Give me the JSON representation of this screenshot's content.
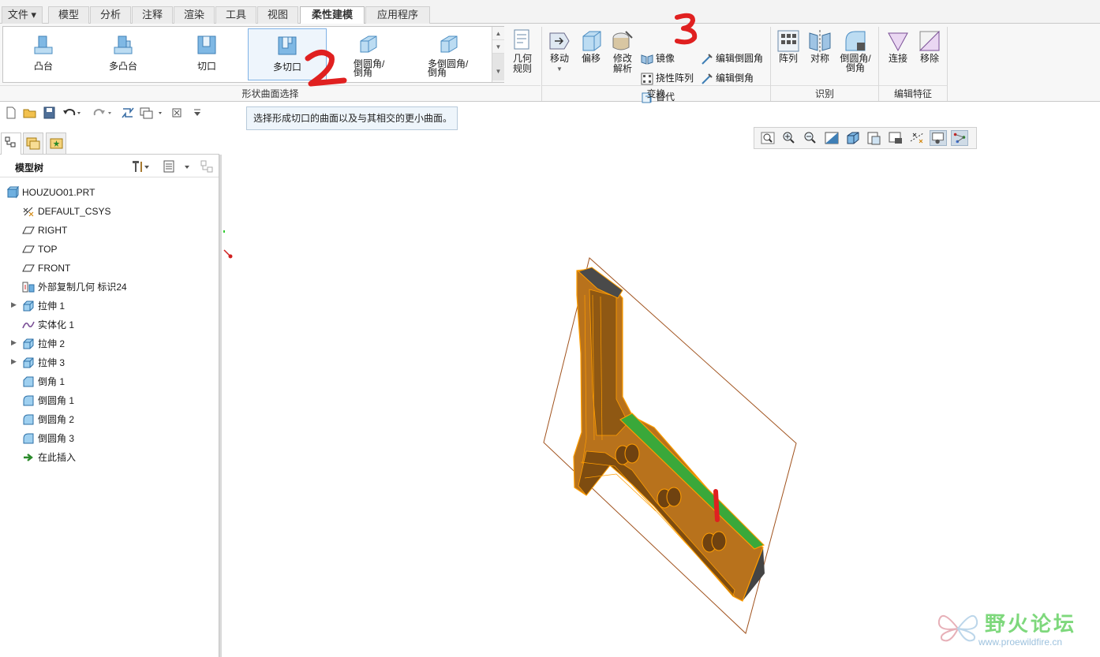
{
  "tabs": [
    {
      "label": "文件"
    },
    {
      "label": "模型"
    },
    {
      "label": "分析"
    },
    {
      "label": "注释"
    },
    {
      "label": "渲染"
    },
    {
      "label": "工具"
    },
    {
      "label": "视图"
    },
    {
      "label": "柔性建模",
      "active": true
    },
    {
      "label": "应用程序"
    }
  ],
  "ribbon": {
    "gallery": {
      "items": [
        {
          "label": "凸台"
        },
        {
          "label": "多凸台"
        },
        {
          "label": "切口"
        },
        {
          "label": "多切口",
          "selected": true
        },
        {
          "label": "倒圆角/\n倒角"
        },
        {
          "label": "多倒圆角/\n倒角"
        }
      ],
      "group_label": "形状曲面选择"
    },
    "geometry_rules": "几何\n规则",
    "transform": {
      "move": "移动",
      "offset": "偏移",
      "modify_analytic": "修改\n解析",
      "mirror": "镜像",
      "flexible_pattern": "挠性阵列",
      "substitute": "替代",
      "edit_round": "编辑倒圆角",
      "edit_chamfer": "编辑倒角",
      "group_label": "变换"
    },
    "recognize": {
      "pattern": "阵列",
      "symmetry": "对称",
      "round_chamfer": "倒圆角/\n倒角",
      "group_label": "识别"
    },
    "edit_feature": {
      "attach": "连接",
      "remove": "移除",
      "group_label": "编辑特征"
    }
  },
  "tooltip": "选择形成切口的曲面以及与其相交的更小曲面。",
  "model_tree": {
    "title": "模型树",
    "items": [
      {
        "label": "HOUZUO01.PRT",
        "icon": "part-icon"
      },
      {
        "label": "DEFAULT_CSYS",
        "icon": "csys-icon"
      },
      {
        "label": "RIGHT",
        "icon": "datum-plane-icon"
      },
      {
        "label": "TOP",
        "icon": "datum-plane-icon"
      },
      {
        "label": "FRONT",
        "icon": "datum-plane-icon"
      },
      {
        "label": "外部复制几何 标识24",
        "icon": "copy-geom-icon"
      },
      {
        "label": "拉伸 1",
        "icon": "extrude-icon",
        "expandable": true
      },
      {
        "label": "实体化 1",
        "icon": "solidify-icon"
      },
      {
        "label": "拉伸 2",
        "icon": "extrude-icon",
        "expandable": true
      },
      {
        "label": "拉伸 3",
        "icon": "extrude-icon",
        "expandable": true
      },
      {
        "label": "倒角 1",
        "icon": "chamfer-icon"
      },
      {
        "label": "倒圆角 1",
        "icon": "round-icon"
      },
      {
        "label": "倒圆角 2",
        "icon": "round-icon"
      },
      {
        "label": "倒圆角 3",
        "icon": "round-icon"
      },
      {
        "label": "在此插入",
        "icon": "insert-here-icon"
      }
    ]
  },
  "annotations": [
    "1",
    "2",
    "3"
  ],
  "watermark": {
    "name": "野火论坛",
    "url": "www.proewildfire.cn"
  },
  "colors": {
    "model": "#b8721c",
    "edge": "#ff9d00",
    "highlight": "#3aa83a",
    "annotation": "#e02020"
  }
}
